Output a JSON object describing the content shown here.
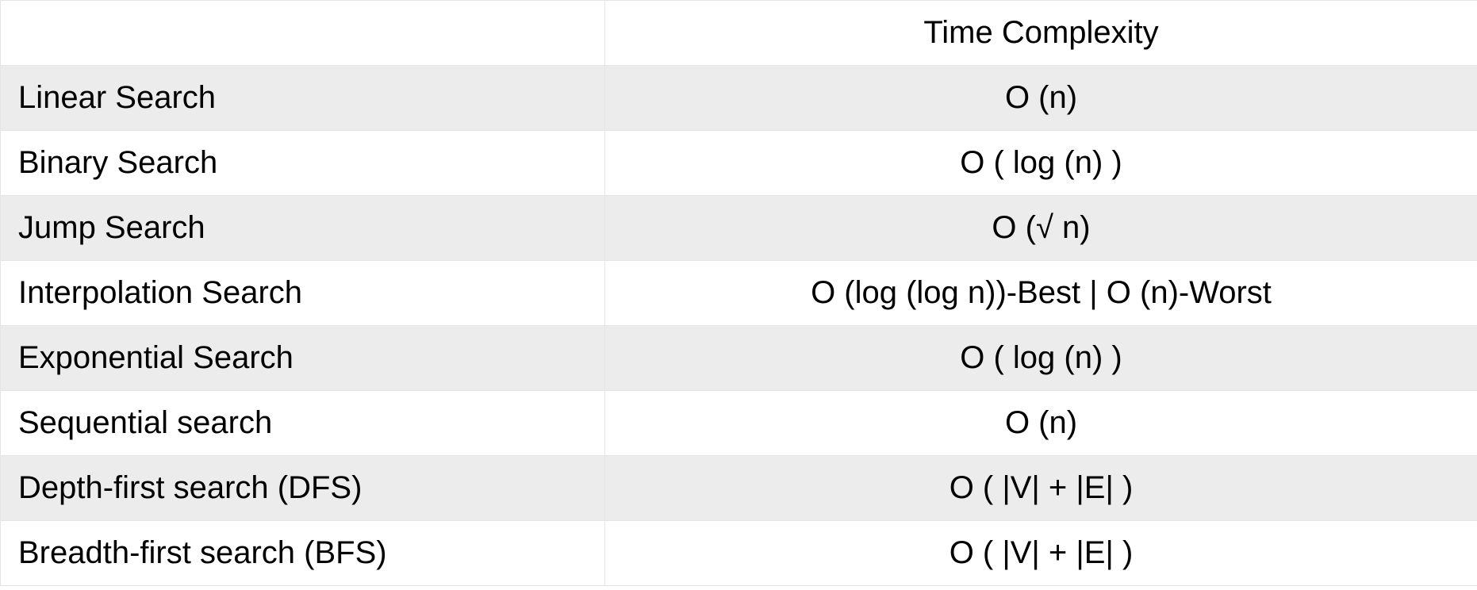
{
  "chart_data": {
    "type": "table",
    "columns": [
      "",
      "Time Complexity"
    ],
    "rows": [
      [
        "Linear Search",
        "O (n)"
      ],
      [
        "Binary Search",
        "O ( log (n) )"
      ],
      [
        "Jump Search",
        "O (√ n)"
      ],
      [
        "Interpolation Search",
        "O (log (log n))-Best | O (n)-Worst"
      ],
      [
        "Exponential Search",
        "O ( log (n) )"
      ],
      [
        "Sequential search",
        "O (n)"
      ],
      [
        "Depth-first search (DFS)",
        "O ( |V| + |E| )"
      ],
      [
        "Breadth-first search (BFS)",
        "O ( |V| + |E| )"
      ]
    ]
  },
  "header": {
    "col0": "",
    "col1": "Time Complexity"
  },
  "rows": {
    "0": {
      "algo": "Linear Search",
      "complexity": "O (n)"
    },
    "1": {
      "algo": "Binary Search",
      "complexity": "O ( log (n) )"
    },
    "2": {
      "algo": "Jump Search",
      "complexity": "O (√ n)"
    },
    "3": {
      "algo": "Interpolation Search",
      "complexity": "O (log (log n))-Best | O (n)-Worst"
    },
    "4": {
      "algo": "Exponential Search",
      "complexity": "O ( log (n) )"
    },
    "5": {
      "algo": "Sequential search",
      "complexity": "O (n)"
    },
    "6": {
      "algo": "Depth-first search (DFS)",
      "complexity": "O ( |V| + |E| )"
    },
    "7": {
      "algo": "Breadth-first search (BFS)",
      "complexity": "O ( |V| + |E| )"
    }
  }
}
